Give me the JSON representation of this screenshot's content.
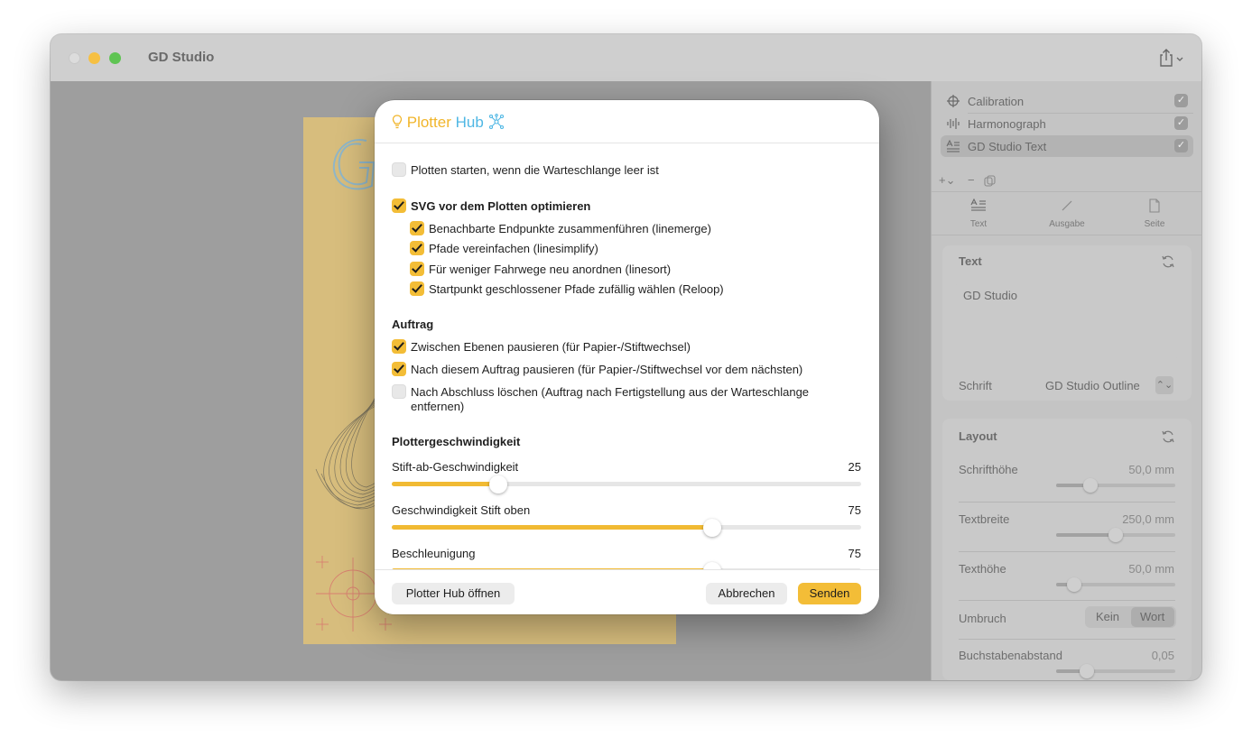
{
  "window": {
    "title": "GD Studio"
  },
  "sidebar": {
    "layers": [
      {
        "label": "Calibration",
        "icon": "crosshair-icon",
        "checked": true
      },
      {
        "label": "Harmonograph",
        "icon": "waveform-icon",
        "checked": true
      },
      {
        "label": "GD Studio Text",
        "icon": "text-lines-icon",
        "checked": true
      }
    ],
    "tabs": [
      {
        "label": "Text",
        "icon": "text-format-icon"
      },
      {
        "label": "Ausgabe",
        "icon": "pen-line-icon"
      },
      {
        "label": "Seite",
        "icon": "page-icon"
      }
    ],
    "text_section": {
      "title": "Text",
      "content": "GD Studio",
      "font_label": "Schrift",
      "font_value": "GD Studio Outline"
    },
    "layout_section": {
      "title": "Layout",
      "font_height_label": "Schrifthöhe",
      "font_height_value": "50,0 mm",
      "text_width_label": "Textbreite",
      "text_width_value": "250,0 mm",
      "text_height_label": "Texthöhe",
      "text_height_value": "50,0 mm",
      "wrap_label": "Umbruch",
      "wrap_options": [
        "Kein",
        "Wort"
      ],
      "wrap_selected": "Wort",
      "spacing_label": "Buchstabenabstand",
      "spacing_value": "0,05"
    }
  },
  "dialog": {
    "brand_part1": "Plotter",
    "brand_part2": "Hub",
    "start_when_empty": "Plotten starten, wenn die Warteschlange leer ist",
    "optimize_header": "SVG vor dem Plotten optimieren",
    "optimize_options": [
      "Benachbarte Endpunkte zusammenführen (linemerge)",
      "Pfade vereinfachen (linesimplify)",
      "Für weniger Fahrwege neu anordnen (linesort)",
      "Startpunkt geschlossener Pfade zufällig wählen (Reloop)"
    ],
    "job_header": "Auftrag",
    "job_options": [
      "Zwischen Ebenen pausieren (für Papier-/Stiftwechsel)",
      "Nach diesem Auftrag pausieren (für Papier-/Stiftwechsel vor dem nächsten)",
      "Nach Abschluss löschen (Auftrag nach Fertigstellung aus der Warteschlange",
      "entfernen)"
    ],
    "speed_header": "Plottergeschwindigkeit",
    "sliders": [
      {
        "label": "Stift-ab-Geschwindigkeit",
        "value": "25"
      },
      {
        "label": "Geschwindigkeit Stift oben",
        "value": "75"
      },
      {
        "label": "Beschleunigung",
        "value": "75"
      }
    ],
    "buttons": {
      "open_hub": "Plotter Hub öffnen",
      "cancel": "Abbrechen",
      "send": "Senden"
    }
  },
  "colors": {
    "accent": "#f3bd37",
    "brand_blue": "#4fb7e4",
    "paper": "#d7bd7d"
  }
}
